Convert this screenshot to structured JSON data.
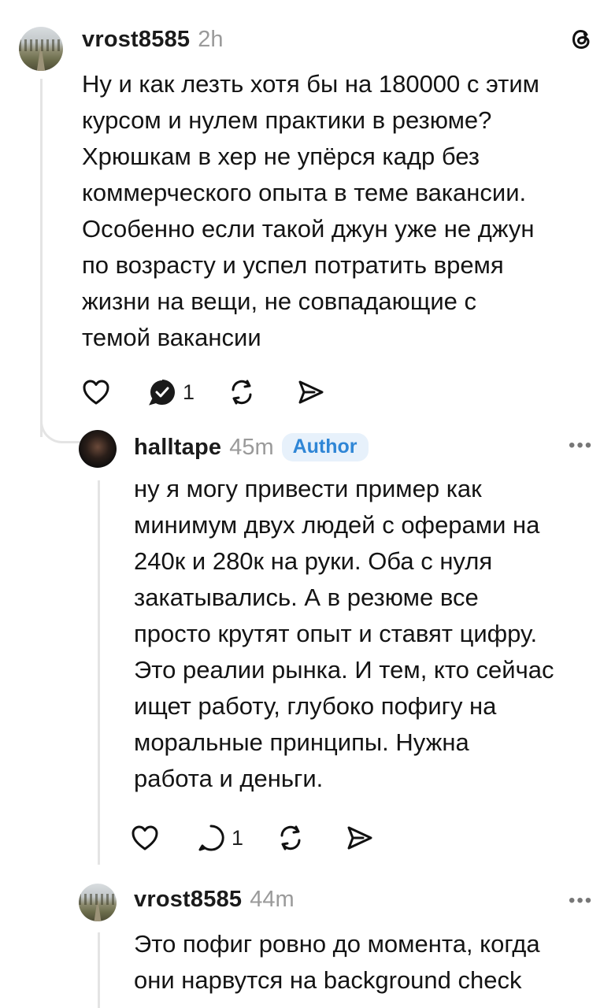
{
  "posts": [
    {
      "username": "vrost8585",
      "time": "2h",
      "text": "Ну и как лезть хотя бы на 180000 с этим\nкурсом и нулем практики в резюме?\nХрюшкам в хер не упёрся кадр без\nкоммерческого опыта в теме вакансии.\nОсобенно если такой джун уже не джун\nпо возрасту и успел потратить время\nжизни на вещи, не совпадающие с\nтемой вакансии",
      "reply_count": "1"
    },
    {
      "username": "halltape",
      "time": "45m",
      "badge": "Author",
      "text": "ну я могу привести пример как\nминимум двух людей с оферами на\n240к и 280к на руки. Оба с нуля\nзакатывались. А в резюме все\nпросто крутят опыт и ставят цифру.\nЭто реалии рынка. И тем, кто сейчас\nищет работу, глубоко пофигу на\nморальные принципы. Нужна\nработа и деньги.",
      "reply_count": "1"
    },
    {
      "username": "vrost8585",
      "time": "44m",
      "text": "Это пофиг ровно до момента, когда\nони нарвутся на background check"
    }
  ],
  "icons": {
    "app": "threads-logo-icon",
    "like": "heart-icon",
    "reply": "comment-bubble-icon",
    "repost": "repost-icon",
    "share": "send-icon",
    "more": "more-dots-icon"
  },
  "colors": {
    "badge_bg": "#e7f1fb",
    "badge_text": "#2f86d6",
    "muted": "#9a9a9a"
  }
}
